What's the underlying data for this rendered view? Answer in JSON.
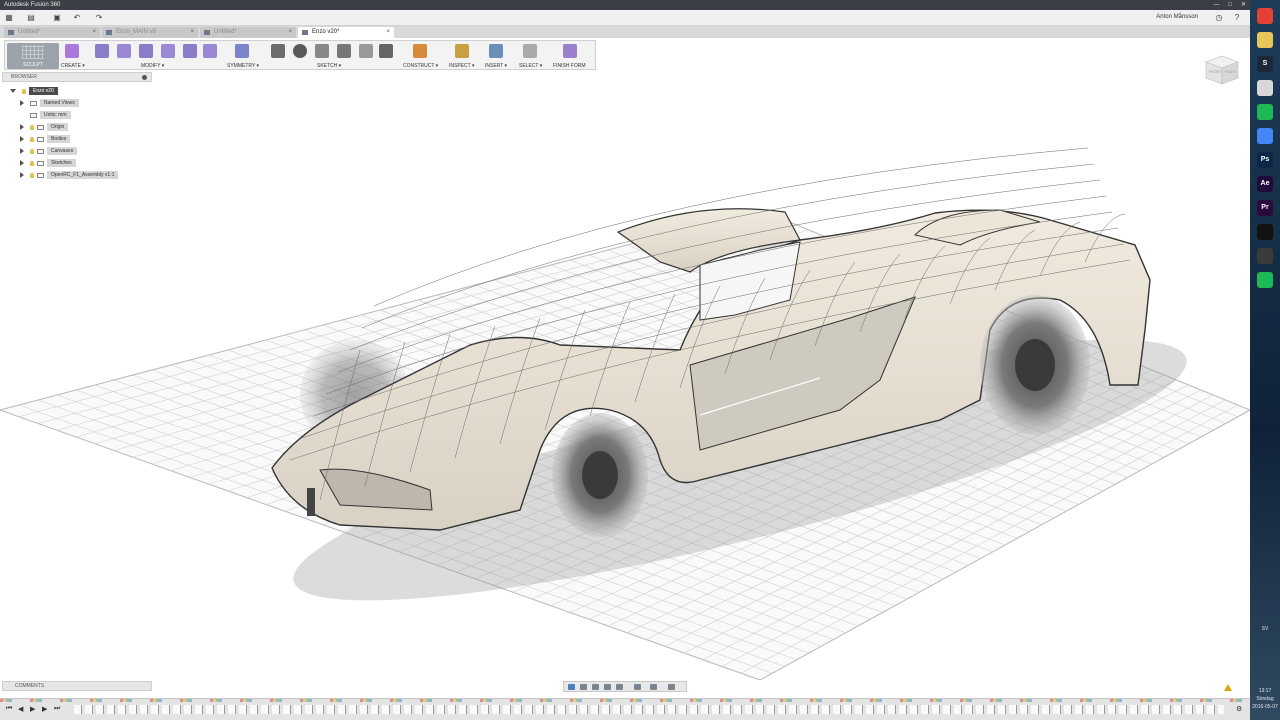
{
  "window": {
    "title": "Autodesk Fusion 360",
    "user": "Anton Månsson"
  },
  "tabs": [
    {
      "label": "Untitled*",
      "active": false
    },
    {
      "label": "Enzo_MAIN v8",
      "active": false
    },
    {
      "label": "Untitled*",
      "active": false
    },
    {
      "label": "Enzo v20*",
      "active": true
    }
  ],
  "toolbar": {
    "mode": "SCULPT",
    "groups": [
      "CREATE ▾",
      "MODIFY ▾",
      "SYMMETRY ▾",
      "SKETCH ▾",
      "CONSTRUCT ▾",
      "INSPECT ▾",
      "INSERT ▾",
      "SELECT ▾",
      "FINISH FORM"
    ]
  },
  "browser": {
    "header": "BROWSER",
    "root": "Enzo v20",
    "items": [
      "Named Views",
      "Units: mm",
      "Origin",
      "Bodies",
      "Canvases",
      "Sketches",
      "OpenRC_F1_Assembly v1:1"
    ]
  },
  "viewcube": {
    "faces": [
      "FRONT",
      "RIGHT"
    ]
  },
  "comments": {
    "label": "COMMENTS"
  },
  "taskbar": {
    "apps": [
      {
        "name": "chrome-icon",
        "color": "#e34133",
        "glyph": ""
      },
      {
        "name": "folder-icon",
        "color": "#e8c65a",
        "glyph": ""
      },
      {
        "name": "steam-icon",
        "color": "#1b2838",
        "glyph": "S"
      },
      {
        "name": "notepad-icon",
        "color": "#d8d8d8",
        "glyph": ""
      },
      {
        "name": "spotify-icon",
        "color": "#1db954",
        "glyph": ""
      },
      {
        "name": "chrome-icon-2",
        "color": "#4285f4",
        "glyph": ""
      },
      {
        "name": "photoshop-icon",
        "color": "#0b2744",
        "glyph": "Ps"
      },
      {
        "name": "after-effects-icon",
        "color": "#1f0a3c",
        "glyph": "Ae"
      },
      {
        "name": "premiere-icon",
        "color": "#2a0a3c",
        "glyph": "Pr"
      },
      {
        "name": "terminal-icon",
        "color": "#111",
        "glyph": ""
      },
      {
        "name": "bulb-icon",
        "color": "#3b3b3b",
        "glyph": ""
      },
      {
        "name": "spotify-icon-2",
        "color": "#1db954",
        "glyph": ""
      }
    ],
    "lang": "SV",
    "time": "13:17",
    "day": "Söndag",
    "date": "2016-05-07"
  }
}
